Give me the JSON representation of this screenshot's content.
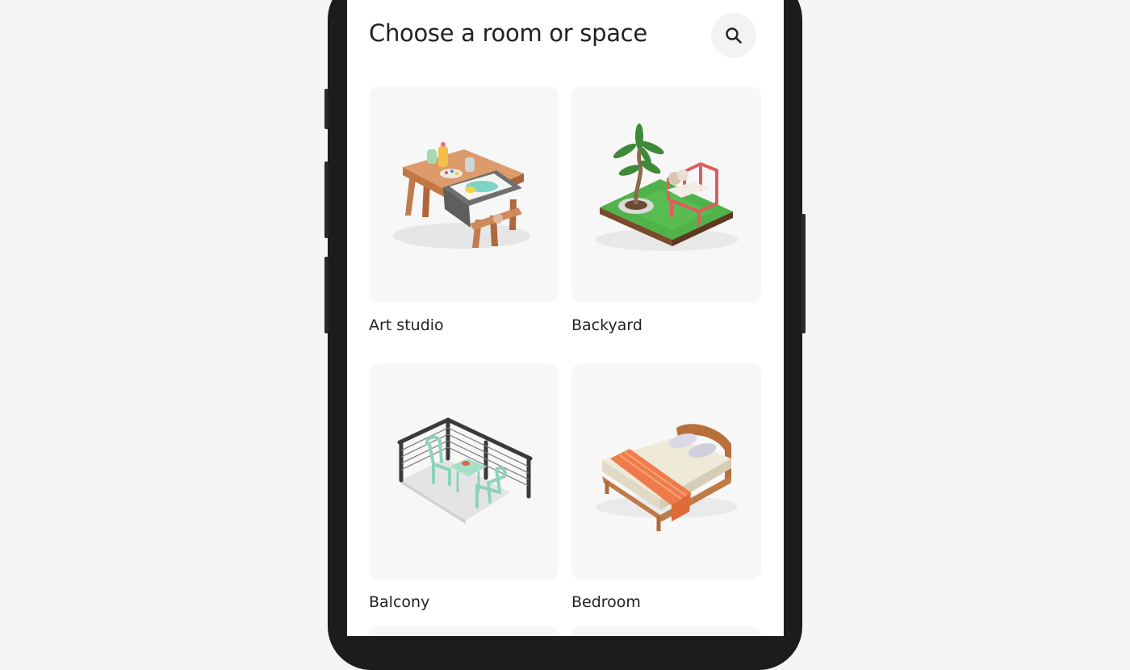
{
  "page": {
    "title": "Choose a room or space"
  },
  "search": {
    "icon": "search-icon"
  },
  "rooms": [
    {
      "label": "Art studio",
      "icon": "art-studio-illustration"
    },
    {
      "label": "Backyard",
      "icon": "backyard-illustration"
    },
    {
      "label": "Balcony",
      "icon": "balcony-illustration"
    },
    {
      "label": "Bedroom",
      "icon": "bedroom-illustration"
    }
  ],
  "colors": {
    "background": "#f5f5f5",
    "screen": "#ffffff",
    "text": "#222222",
    "card": "#f7f7f7",
    "search_button": "#f3f3f3"
  }
}
